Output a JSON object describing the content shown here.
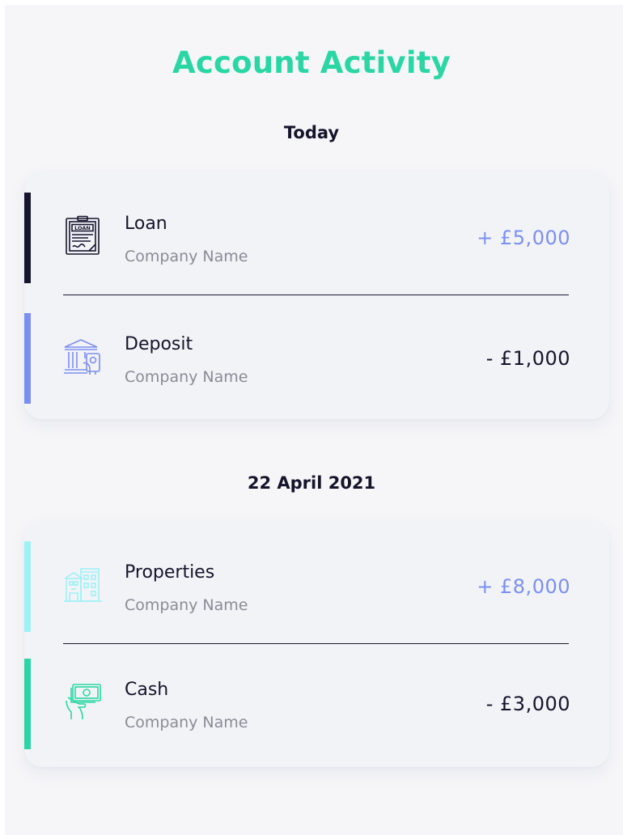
{
  "header": {
    "title": "Account Activity"
  },
  "colors": {
    "title": "#2ad7a4",
    "positive_amount": "#7b8ff0",
    "negative_amount": "#15142b",
    "subtitle_text": "#8b8b96"
  },
  "sections": [
    {
      "date": "Today",
      "transactions": [
        {
          "title": "Loan",
          "company": "Company Name",
          "amount": "+ £5,000",
          "icon": "loan-document-icon",
          "accent": "#16152e",
          "amount_color": "#7b8ff0"
        },
        {
          "title": "Deposit",
          "company": "Company Name",
          "amount": "- £1,000",
          "icon": "bank-deposit-icon",
          "accent": "#7b8ff0",
          "amount_color": "#15142b"
        }
      ]
    },
    {
      "date": "22 April 2021",
      "transactions": [
        {
          "title": "Properties",
          "company": "Company Name",
          "amount": "+ £8,000",
          "icon": "buildings-icon",
          "accent": "#9ff1f5",
          "amount_color": "#7b8ff0"
        },
        {
          "title": "Cash",
          "company": "Company Name",
          "amount": "- £3,000",
          "icon": "cash-hand-icon",
          "accent": "#2ad7a4",
          "amount_color": "#15142b"
        }
      ]
    }
  ]
}
